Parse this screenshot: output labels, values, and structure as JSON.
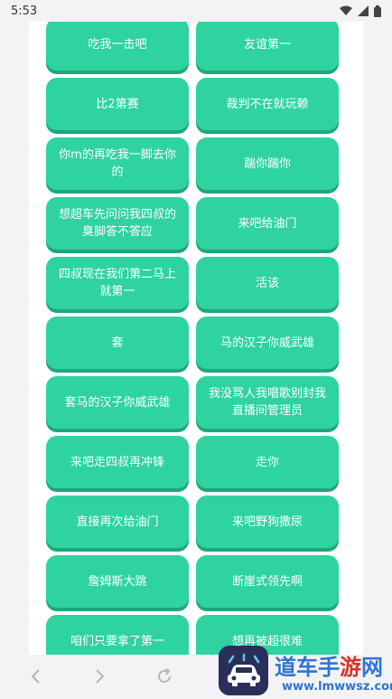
{
  "status": {
    "time": "5:53",
    "icons": [
      "wifi-icon",
      "signal-icon",
      "battery-icon"
    ]
  },
  "buttons": [
    "吃我一击吧",
    "友谊第一",
    "比2第赛",
    "裁判不在就玩赖",
    "你m的再吃我一脚去你的",
    "踹你踹你",
    "想超车先问问我四叔的臭脚答不答应",
    "来吧给油门",
    "四叔现在我们第二马上就第一",
    "活该",
    "套",
    "马的汉子你威武雄",
    "套马的汉子你威武雄",
    "我没骂人我唱歌别封我直播间管理员",
    "来吧走四叔再冲锋",
    "走你",
    "直接再次给油门",
    "来吧野狗撒尿",
    "詹姆斯大跳",
    "断崖式领先啊",
    "咱们只要拿了第一",
    "想再被超很难"
  ],
  "navigation": {
    "icons": [
      "back-icon",
      "forward-icon",
      "reload-icon"
    ]
  },
  "watermark": {
    "title_main": "道车手",
    "title_accent": "游",
    "title_end": "网",
    "url": "www.lmwwsz.com"
  },
  "colors": {
    "button": "#2ed3a0",
    "button_shadow": "#1da77b",
    "watermark_blue": "#2f74d6",
    "watermark_red": "#d9342b"
  }
}
